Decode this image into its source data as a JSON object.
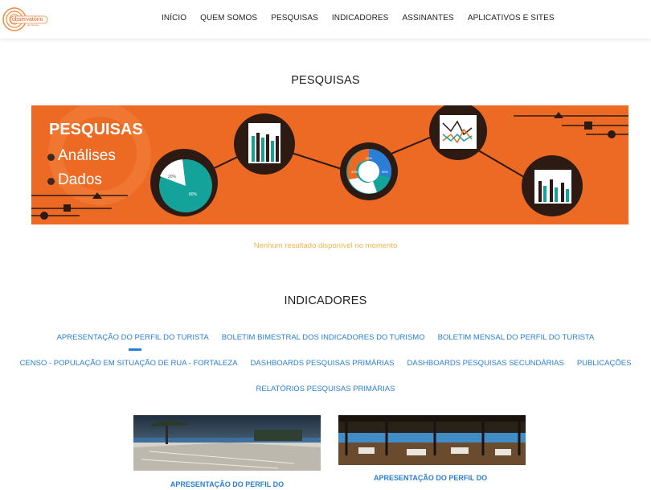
{
  "header": {
    "logo_text": "observatório",
    "logo_subtext": "do turismo",
    "nav": [
      "INÍCIO",
      "QUEM SOMOS",
      "PESQUISAS",
      "INDICADORES",
      "ASSINANTES",
      "APLICATIVOS E SITES"
    ]
  },
  "pesquisas": {
    "title": "PESQUISAS",
    "banner": {
      "heading": "PESQUISAS",
      "item1": "Análises",
      "item2": "Dados",
      "pie_small_label": "20%",
      "pie_large_label": "80%",
      "donut_labels": [
        "20%",
        "40%",
        "50%"
      ]
    },
    "empty_message": "Nenhum resultado disponível no momento"
  },
  "indicadores": {
    "title": "INDICADORES",
    "tabs_row1": [
      "APRESENTAÇÃO DO PERFIL DO TURISTA",
      "BOLETIM BIMESTRAL DOS INDICADORES DO TURISMO",
      "BOLETIM MENSAL DO PERFIL DO TURISTA"
    ],
    "tabs_row2": [
      "CENSO - POPULAÇÃO EM SITUAÇÃO DE RUA - FORTALEZA",
      "DASHBOARDS PESQUISAS PRIMÁRIAS",
      "DASHBOARDS PESQUISAS SECUNDÁRIAS",
      "PUBLICAÇÕES"
    ],
    "tabs_row3": [
      "RELATÓRIOS PESQUISAS PRIMÁRIAS"
    ],
    "cards": [
      {
        "title": "APRESENTAÇÃO DO PERFIL DO"
      },
      {
        "title": "APRESENTAÇÃO DO PERFIL DO"
      }
    ]
  },
  "colors": {
    "accent": "#2a7fd4",
    "banner_orange": "#ec6a24",
    "teal": "#13a39a",
    "empty_message": "#f0b54a"
  }
}
